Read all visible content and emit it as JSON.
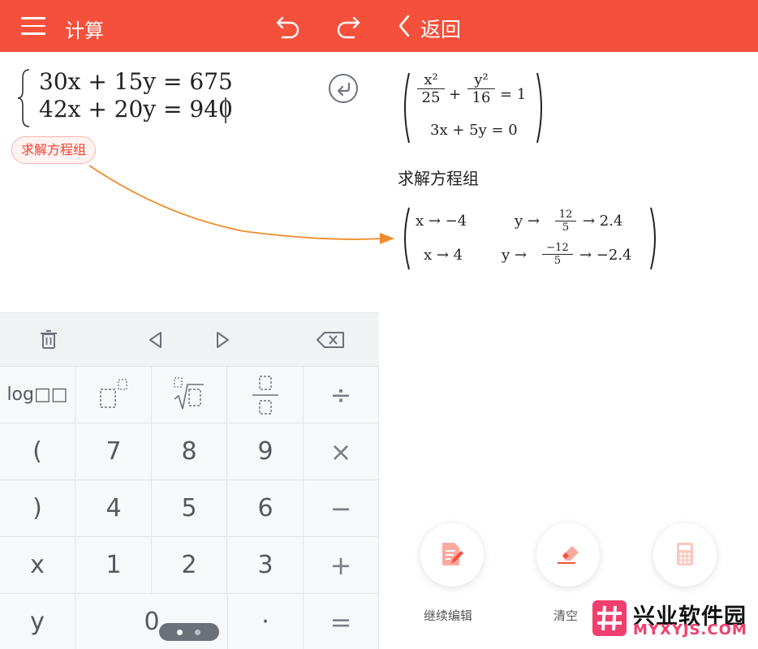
{
  "header": {
    "title": "计算",
    "back_label": "返回"
  },
  "editor": {
    "equations": [
      "30x + 15y = 675",
      "42x + 20y = 940"
    ],
    "solve_chip": "求解方程组"
  },
  "result": {
    "system": {
      "eq1": {
        "term1_num": "x²",
        "term1_den": "25",
        "plus": "+",
        "term2_num": "y²",
        "term2_den": "16",
        "rhs": "= 1"
      },
      "eq2": "3x + 5y = 0"
    },
    "title": "求解方程组",
    "solutions": [
      {
        "x_part": "x → −4",
        "y_prefix": "y →",
        "frac_num": "12",
        "frac_den": "5",
        "approx": "→ 2.4"
      },
      {
        "x_part": "x → 4",
        "y_prefix": "y →",
        "frac_num": "−12",
        "frac_den": "5",
        "approx": "→ −2.4"
      }
    ]
  },
  "keypad": {
    "toolbar_icons": [
      "trash-icon",
      "cursor-left-icon",
      "cursor-right-icon",
      "backspace-icon"
    ],
    "rows": [
      [
        "log□□",
        "□²",
        "²√□",
        "□/□",
        "÷"
      ],
      [
        "(",
        "7",
        "8",
        "9",
        "×"
      ],
      [
        ")",
        "4",
        "5",
        "6",
        "−"
      ],
      [
        "x",
        "1",
        "2",
        "3",
        "+"
      ],
      [
        "y",
        "0",
        "",
        "·",
        "="
      ]
    ]
  },
  "actions": {
    "continue_edit": "继续编辑",
    "clear": "清空",
    "calculator_icon": "calculator-icon"
  },
  "watermark": {
    "name": "兴业软件园",
    "url": "MYXYJS.COM"
  },
  "colors": {
    "brand": "#f5503b",
    "chip_text": "#f0412e",
    "arrow": "#f08a2a",
    "watermark_pink": "#f03f6e"
  }
}
